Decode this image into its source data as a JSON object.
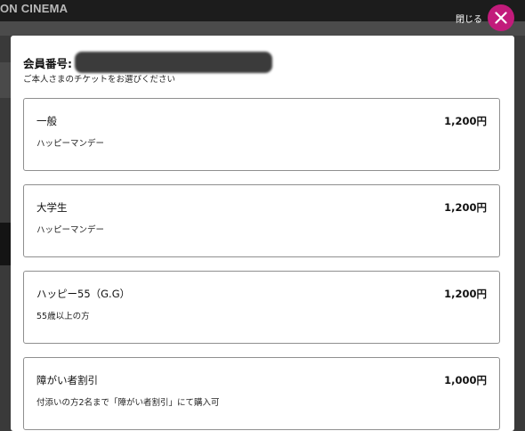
{
  "background": {
    "logo_text": "ON CINEMA"
  },
  "close": {
    "label": "閉じる",
    "icon": "close-icon",
    "color": "#c21b7b"
  },
  "modal": {
    "member_label": "会員番号:",
    "subtitle": "ご本人さまのチケットをお選びください",
    "tickets": [
      {
        "name": "一般",
        "description": "ハッピーマンデー",
        "price": "1,200円"
      },
      {
        "name": "大学生",
        "description": "ハッピーマンデー",
        "price": "1,200円"
      },
      {
        "name": "ハッピー55（G.G）",
        "description": "55歳以上の方",
        "price": "1,200円"
      },
      {
        "name": "障がい者割引",
        "description": "付添いの方2名まで「障がい者割引」にて購入可",
        "price": "1,000円"
      }
    ]
  }
}
